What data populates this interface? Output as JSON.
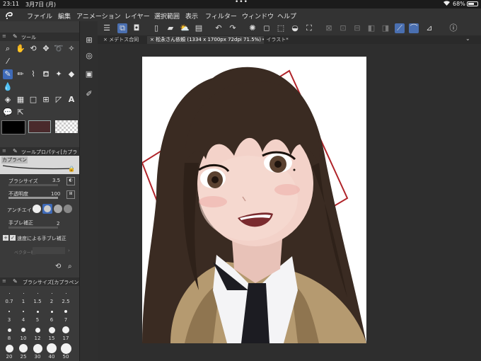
{
  "status": {
    "time": "23:11",
    "date": "3月7日 (月)",
    "battery": "68%",
    "battery_level": 0.68
  },
  "menu": [
    "ファイル",
    "編集",
    "アニメーション",
    "レイヤー",
    "選択範囲",
    "表示",
    "フィルター",
    "ウィンドウ",
    "ヘルプ"
  ],
  "tool_panel": {
    "title": "ツール"
  },
  "tool_property": {
    "title": "ツールプロパティ[カプラ",
    "brush_name": "カプラペン",
    "brush_size_label": "ブラシサイズ",
    "brush_size_value": "3.5",
    "opacity_label": "不透明度",
    "opacity_value": "100",
    "antialias_label": "アンチエイリ",
    "stabilization_label": "手ブレ補正",
    "stabilization_value": "2",
    "speed_stabilization_label": "速度による手ブレ補正",
    "vector_label": "ベクター吸"
  },
  "brush_size_panel": {
    "title": "ブラシサイズ[カプラペン",
    "sizes": [
      "0.7",
      "1",
      "1.5",
      "2",
      "2.5",
      "3",
      "4",
      "5",
      "6",
      "7",
      "8",
      "10",
      "12",
      "15",
      "17",
      "20",
      "25",
      "30",
      "40",
      "50"
    ]
  },
  "tabs": [
    {
      "label": "メデトス合同"
    },
    {
      "label": "松永さん依頼 (1334 x 1700px 72dpi 71.5%)"
    },
    {
      "label": "イラスト*"
    }
  ],
  "colors": {
    "accent": "#3e6ab8",
    "main_color": "#000000",
    "sub_color": "#4a2a2c"
  }
}
